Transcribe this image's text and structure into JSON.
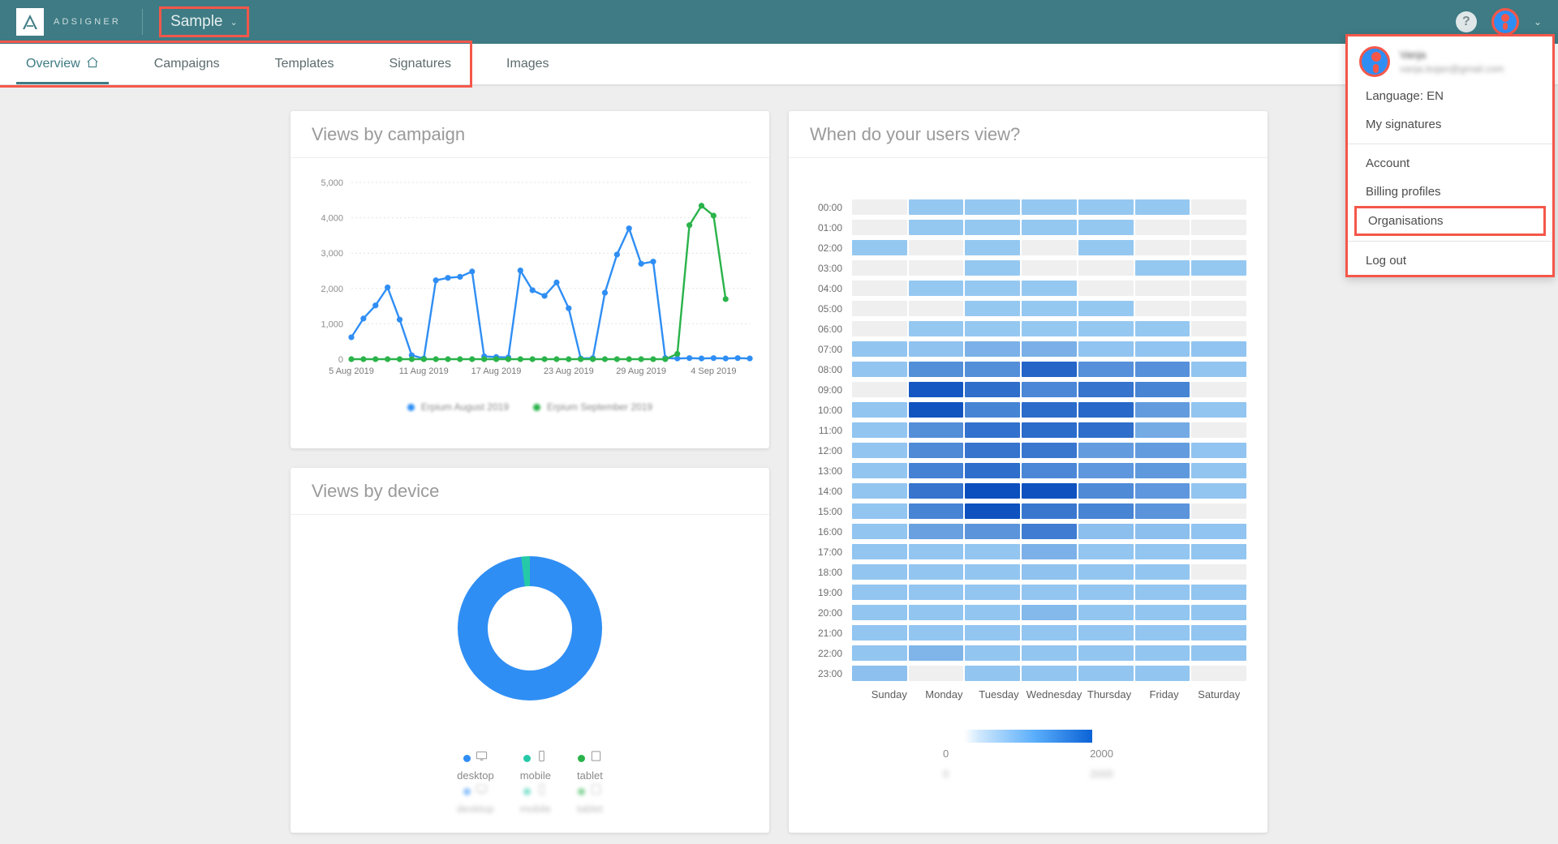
{
  "topbar": {
    "logo_text": "ADSIGNER",
    "org_label": "Sample",
    "caret": "⌄",
    "help_label": "?"
  },
  "tabs": [
    {
      "label": "Overview",
      "icon": "home-icon",
      "active": true
    },
    {
      "label": "Campaigns",
      "active": false
    },
    {
      "label": "Templates",
      "active": false
    },
    {
      "label": "Signatures",
      "active": false
    },
    {
      "label": "Images",
      "active": false
    }
  ],
  "user_menu": {
    "name": "Vanja",
    "email": "vanja.bojan@gmail.com",
    "items": [
      {
        "label": "Language: EN",
        "highlighted": false
      },
      {
        "label": "My signatures",
        "highlighted": false
      },
      {
        "label": "Account",
        "highlighted": false
      },
      {
        "label": "Billing profiles",
        "highlighted": false
      },
      {
        "label": "Organisations",
        "highlighted": true
      },
      {
        "label": "Log out",
        "highlighted": false
      }
    ]
  },
  "cards": {
    "views_by_campaign": "Views by campaign",
    "views_by_device": "Views by device",
    "when_users_view": "When do your users view?"
  },
  "colors": {
    "brand_teal": "#3e7b84",
    "highlight_red": "#f4574a",
    "series_blue": "#2f8ef4",
    "series_green": "#2ab34a",
    "mobile_teal": "#25c9a8"
  },
  "chart_data": [
    {
      "type": "line",
      "title": "Views by campaign",
      "xlabel": "",
      "ylabel": "",
      "ylim": [
        0,
        5000
      ],
      "yticks": [
        0,
        1000,
        2000,
        3000,
        4000,
        5000
      ],
      "ytick_labels": [
        "0",
        "1,000",
        "2,000",
        "3,000",
        "4,000",
        "5,000"
      ],
      "xtick_labels": [
        "5 Aug 2019",
        "11 Aug 2019",
        "17 Aug 2019",
        "23 Aug 2019",
        "29 Aug 2019",
        "4 Sep 2019"
      ],
      "grid": true,
      "legend_position": "bottom",
      "x": [
        "5 Aug 2019",
        "6 Aug 2019",
        "7 Aug 2019",
        "8 Aug 2019",
        "9 Aug 2019",
        "10 Aug 2019",
        "11 Aug 2019",
        "12 Aug 2019",
        "13 Aug 2019",
        "14 Aug 2019",
        "15 Aug 2019",
        "16 Aug 2019",
        "17 Aug 2019",
        "18 Aug 2019",
        "19 Aug 2019",
        "20 Aug 2019",
        "21 Aug 2019",
        "22 Aug 2019",
        "23 Aug 2019",
        "24 Aug 2019",
        "25 Aug 2019",
        "26 Aug 2019",
        "27 Aug 2019",
        "28 Aug 2019",
        "29 Aug 2019",
        "30 Aug 2019",
        "31 Aug 2019",
        "1 Sep 2019",
        "2 Sep 2019",
        "3 Sep 2019",
        "4 Sep 2019",
        "5 Sep 2019",
        "6 Sep 2019",
        "7 Sep 2019"
      ],
      "series": [
        {
          "name": "Erpium August 2019",
          "color": "#2f8ef4",
          "values": [
            620,
            1150,
            1520,
            2030,
            1120,
            110,
            20,
            2230,
            2300,
            2330,
            2480,
            80,
            60,
            50,
            2510,
            1950,
            1790,
            2170,
            1440,
            20,
            30,
            1880,
            2960,
            3700,
            2700,
            2760,
            30,
            20,
            30,
            20,
            30,
            20,
            30,
            20
          ]
        },
        {
          "name": "Erpium September 2019",
          "color": "#2ab34a",
          "values": [
            0,
            0,
            0,
            0,
            0,
            0,
            0,
            0,
            0,
            0,
            0,
            0,
            0,
            0,
            0,
            0,
            0,
            0,
            0,
            0,
            0,
            0,
            0,
            0,
            0,
            0,
            0,
            150,
            3790,
            4340,
            4060,
            1700,
            null,
            null
          ]
        }
      ]
    },
    {
      "type": "pie",
      "title": "Views by device",
      "donut": true,
      "labels": [
        "desktop",
        "mobile",
        "tablet"
      ],
      "values": [
        98,
        2,
        0
      ],
      "colors": [
        "#2f8ef4",
        "#25c9a8",
        "#2ab34a"
      ],
      "legend_position": "bottom"
    },
    {
      "type": "heatmap",
      "title": "When do your users view?",
      "xlabel": "",
      "ylabel": "",
      "x_categories": [
        "Sunday",
        "Monday",
        "Tuesday",
        "Wednesday",
        "Thursday",
        "Friday",
        "Saturday"
      ],
      "y_categories": [
        "00:00",
        "01:00",
        "02:00",
        "03:00",
        "04:00",
        "05:00",
        "06:00",
        "07:00",
        "08:00",
        "09:00",
        "10:00",
        "11:00",
        "12:00",
        "13:00",
        "14:00",
        "15:00",
        "16:00",
        "17:00",
        "18:00",
        "19:00",
        "20:00",
        "21:00",
        "22:00",
        "23:00"
      ],
      "colorbar": {
        "min": 0,
        "max": 2000,
        "min_label": "0",
        "max_label": "2000"
      },
      "values": [
        [
          0,
          180,
          180,
          180,
          180,
          180,
          0
        ],
        [
          0,
          180,
          180,
          180,
          180,
          0,
          0
        ],
        [
          180,
          0,
          180,
          0,
          180,
          0,
          0
        ],
        [
          0,
          0,
          180,
          0,
          0,
          180,
          180
        ],
        [
          0,
          180,
          180,
          180,
          0,
          0,
          0
        ],
        [
          0,
          0,
          180,
          180,
          180,
          0,
          0
        ],
        [
          0,
          180,
          180,
          180,
          180,
          180,
          0
        ],
        [
          200,
          230,
          420,
          430,
          210,
          210,
          210
        ],
        [
          200,
          900,
          900,
          1550,
          860,
          860,
          200
        ],
        [
          0,
          1800,
          1400,
          1000,
          1300,
          1050,
          0
        ],
        [
          200,
          1850,
          1050,
          1450,
          1500,
          700,
          200
        ],
        [
          200,
          900,
          1350,
          1450,
          1400,
          500,
          0
        ],
        [
          200,
          950,
          1300,
          1250,
          700,
          700,
          210
        ],
        [
          200,
          1100,
          1400,
          1000,
          760,
          740,
          200
        ],
        [
          200,
          1300,
          1950,
          1900,
          950,
          760,
          200
        ],
        [
          200,
          1050,
          1900,
          1250,
          1050,
          800,
          0
        ],
        [
          200,
          640,
          800,
          1150,
          260,
          260,
          210
        ],
        [
          200,
          200,
          200,
          420,
          200,
          200,
          200
        ],
        [
          200,
          200,
          200,
          230,
          200,
          200,
          0
        ],
        [
          200,
          200,
          200,
          200,
          200,
          200,
          200
        ],
        [
          200,
          200,
          200,
          330,
          200,
          200,
          200
        ],
        [
          200,
          200,
          200,
          200,
          200,
          200,
          200
        ],
        [
          200,
          380,
          200,
          200,
          200,
          200,
          200
        ],
        [
          250,
          0,
          200,
          200,
          200,
          200,
          0
        ]
      ]
    }
  ]
}
